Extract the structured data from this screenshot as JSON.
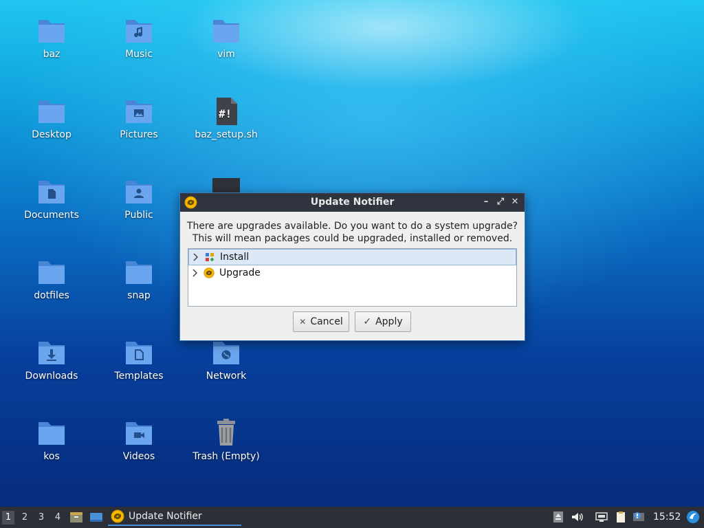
{
  "desktop": {
    "icons": [
      {
        "label": "baz"
      },
      {
        "label": "Music"
      },
      {
        "label": "vim"
      },
      {
        "label": "Desktop"
      },
      {
        "label": "Pictures"
      },
      {
        "label": "baz_setup.sh"
      },
      {
        "label": "Documents"
      },
      {
        "label": "Public"
      },
      {
        "label": "dotfiles"
      },
      {
        "label": "snap"
      },
      {
        "label": "Downloads"
      },
      {
        "label": "Templates"
      },
      {
        "label": "Network"
      },
      {
        "label": "kos"
      },
      {
        "label": "Videos"
      },
      {
        "label": "Trash (Empty)"
      }
    ]
  },
  "dialog": {
    "title": "Update Notifier",
    "message_line1": "There are upgrades available. Do you want to do a system upgrade?",
    "message_line2": "This will mean packages could be upgraded, installed or removed.",
    "tree": [
      {
        "label": "Install"
      },
      {
        "label": "Upgrade"
      }
    ],
    "cancel_label": "Cancel",
    "apply_label": "Apply"
  },
  "taskbar": {
    "workspaces": [
      "1",
      "2",
      "3",
      "4"
    ],
    "task_label": "Update Notifier",
    "clock": "15:52"
  },
  "colors": {
    "folder": "#5b9bea",
    "accent": "#4a90d9",
    "titlebar": "#2f343f"
  }
}
